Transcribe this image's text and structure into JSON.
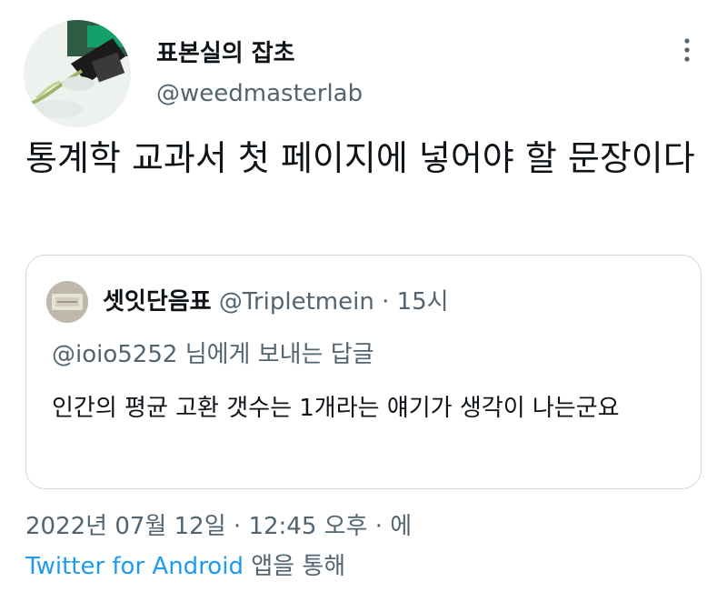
{
  "author": {
    "display_name": "표본실의 잡초",
    "handle": "@weedmasterlab"
  },
  "tweet": {
    "text": "통계학 교과서 첫 페이지에 넣어야 할 문장이다"
  },
  "quote": {
    "display_name": "셋잇단음표",
    "handle": "@Tripletmein",
    "separator": "·",
    "time": "15시",
    "reply_to": "@ioio5252 님에게 보내는 답글",
    "text": "인간의 평균 고환 갯수는 1개라는 얘기가 생각이 나는군요"
  },
  "meta": {
    "date": "2022년 07월 12일",
    "separator": "·",
    "time": "12:45 오후",
    "suffix": "에",
    "source_app": "Twitter for Android",
    "source_suffix": "앱을 통해"
  },
  "icons": {
    "more": "more-vertical-icon"
  },
  "colors": {
    "text": "#0f1419",
    "secondary": "#536471",
    "link": "#1d9bf0",
    "border": "#cfd9de"
  }
}
